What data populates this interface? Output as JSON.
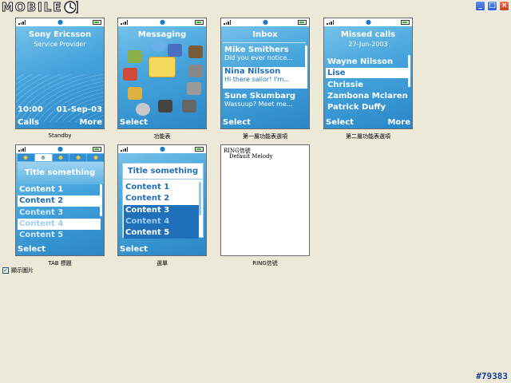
{
  "app": {
    "logo_text": "MOBILE",
    "window_buttons": [
      "_",
      "□",
      "×"
    ]
  },
  "screens": {
    "standby": {
      "caption": "Standby",
      "title": "Sony Ericsson",
      "subtitle": "Service Provider",
      "time": "10:00",
      "date": "01-Sep-03",
      "soft_left": "Calls",
      "soft_right": "More"
    },
    "messaging": {
      "caption": "功能表",
      "title": "Messaging",
      "soft_left": "Select"
    },
    "inbox": {
      "caption": "第一層功能表選項",
      "title": "Inbox",
      "items": [
        {
          "name": "Mike Smithers",
          "msg": "Did you ever notice..."
        },
        {
          "name": "Nina Nilsson",
          "msg": "Hi there sailor! I'm..."
        },
        {
          "name": "Sune Skumbarg",
          "msg": "Wassuup?  Meet me..."
        }
      ],
      "soft_left": "Select"
    },
    "missed_calls": {
      "caption": "第二層功能表選項",
      "title": "Missed calls",
      "date": "27-Jun-2003",
      "items": [
        "Wayne Nilsson",
        "Lise",
        "Chrissie",
        "Zambona Mclaren",
        "Patrick Duffy"
      ],
      "soft_left": "Select",
      "soft_right": "More"
    },
    "tab": {
      "caption": "TAB 標題",
      "title": "Title something",
      "items": [
        "Content 1",
        "Content 2",
        "Content 3",
        "Content 4",
        "Content 5"
      ],
      "soft_left": "Select"
    },
    "menu": {
      "caption": "選單",
      "title": "Title something",
      "items": [
        "Content 1",
        "Content 2",
        "Content 3",
        "Content 4",
        "Content 5"
      ],
      "soft_left": "Select"
    },
    "ring": {
      "caption": "RING信號",
      "title": "RING信號",
      "item": "Default Melody"
    }
  },
  "options": {
    "show_images_label": "顯示圖片",
    "show_images_checked": "✔"
  },
  "watermark": "#79383",
  "colors": {
    "screen_blue": "#46a5dc",
    "highlight": "#1f70b8",
    "background": "#ece9d8"
  }
}
